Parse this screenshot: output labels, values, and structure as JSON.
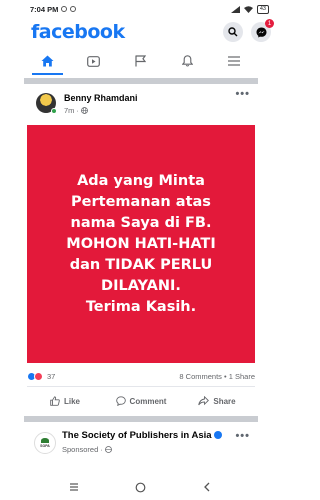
{
  "status_bar": {
    "time": "7:04 PM",
    "battery": "43"
  },
  "header": {
    "logo": "facebook",
    "messenger_badge": "1"
  },
  "nav_tabs": [
    "home-icon",
    "video-icon",
    "flag-icon",
    "bell-icon",
    "menu-icon"
  ],
  "post": {
    "author": "Benny Rhamdani",
    "time": "7m",
    "privacy_icon": "globe-icon",
    "text_lines": [
      "Ada yang Minta",
      "Pertemanan atas",
      "nama Saya di FB.",
      "MOHON HATI-HATI",
      "dan TIDAK PERLU",
      "DILAYANI.",
      "Terima Kasih."
    ],
    "background_color": "#e3193a",
    "reaction_count": "37",
    "comments_shares": "8 Comments • 1 Share",
    "actions": {
      "like": "Like",
      "comment": "Comment",
      "share": "Share"
    }
  },
  "sponsored": {
    "title": "The Society of Publishers in Asia",
    "label": "Sponsored",
    "avatar_text": "SOPA"
  },
  "colors": {
    "brand": "#1877f2",
    "post_bg": "#e3193a"
  }
}
